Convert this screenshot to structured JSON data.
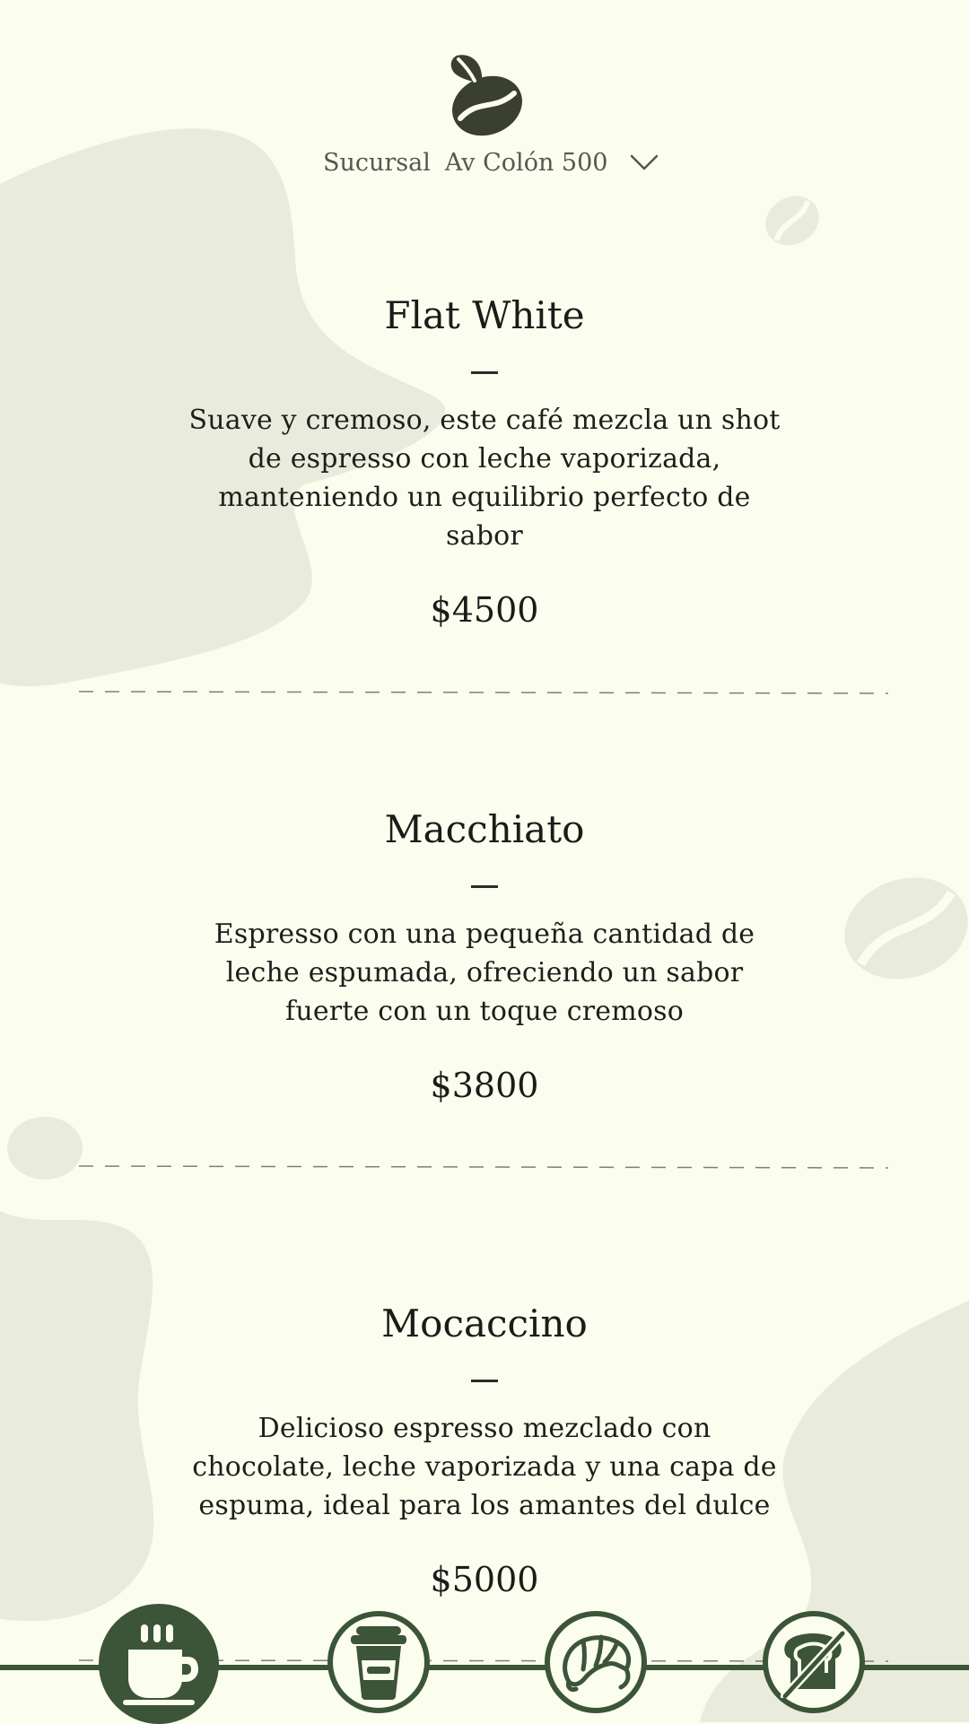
{
  "header": {
    "branch_label": "Sucursal",
    "branch_value": "Av Colón 500"
  },
  "menu_items": [
    {
      "name": "Flat White",
      "description": "Suave y cremoso, este café mezcla un shot de espresso con leche vaporizada, manteniendo un equilibrio perfecto de sabor",
      "price": "$4500"
    },
    {
      "name": "Macchiato",
      "description": "Espresso con una pequeña cantidad de leche espumada, ofreciendo un sabor fuerte con un toque cremoso",
      "price": "$3800"
    },
    {
      "name": "Mocaccino",
      "description": "Delicioso espresso mezclado con chocolate, leche vaporizada y una capa de espuma, ideal para los amantes del dulce",
      "price": "$5000"
    }
  ],
  "bottom_nav": [
    {
      "icon": "hot-coffee-cup-icon",
      "active": true
    },
    {
      "icon": "takeaway-cup-icon",
      "active": false
    },
    {
      "icon": "croissant-icon",
      "active": false
    },
    {
      "icon": "gluten-free-toast-icon",
      "active": false
    }
  ],
  "colors": {
    "background": "#fbfeef",
    "blob": "#e9ecdd",
    "accent_green": "#3c5437",
    "text": "#1d1f1a",
    "muted_text": "#55584f"
  }
}
